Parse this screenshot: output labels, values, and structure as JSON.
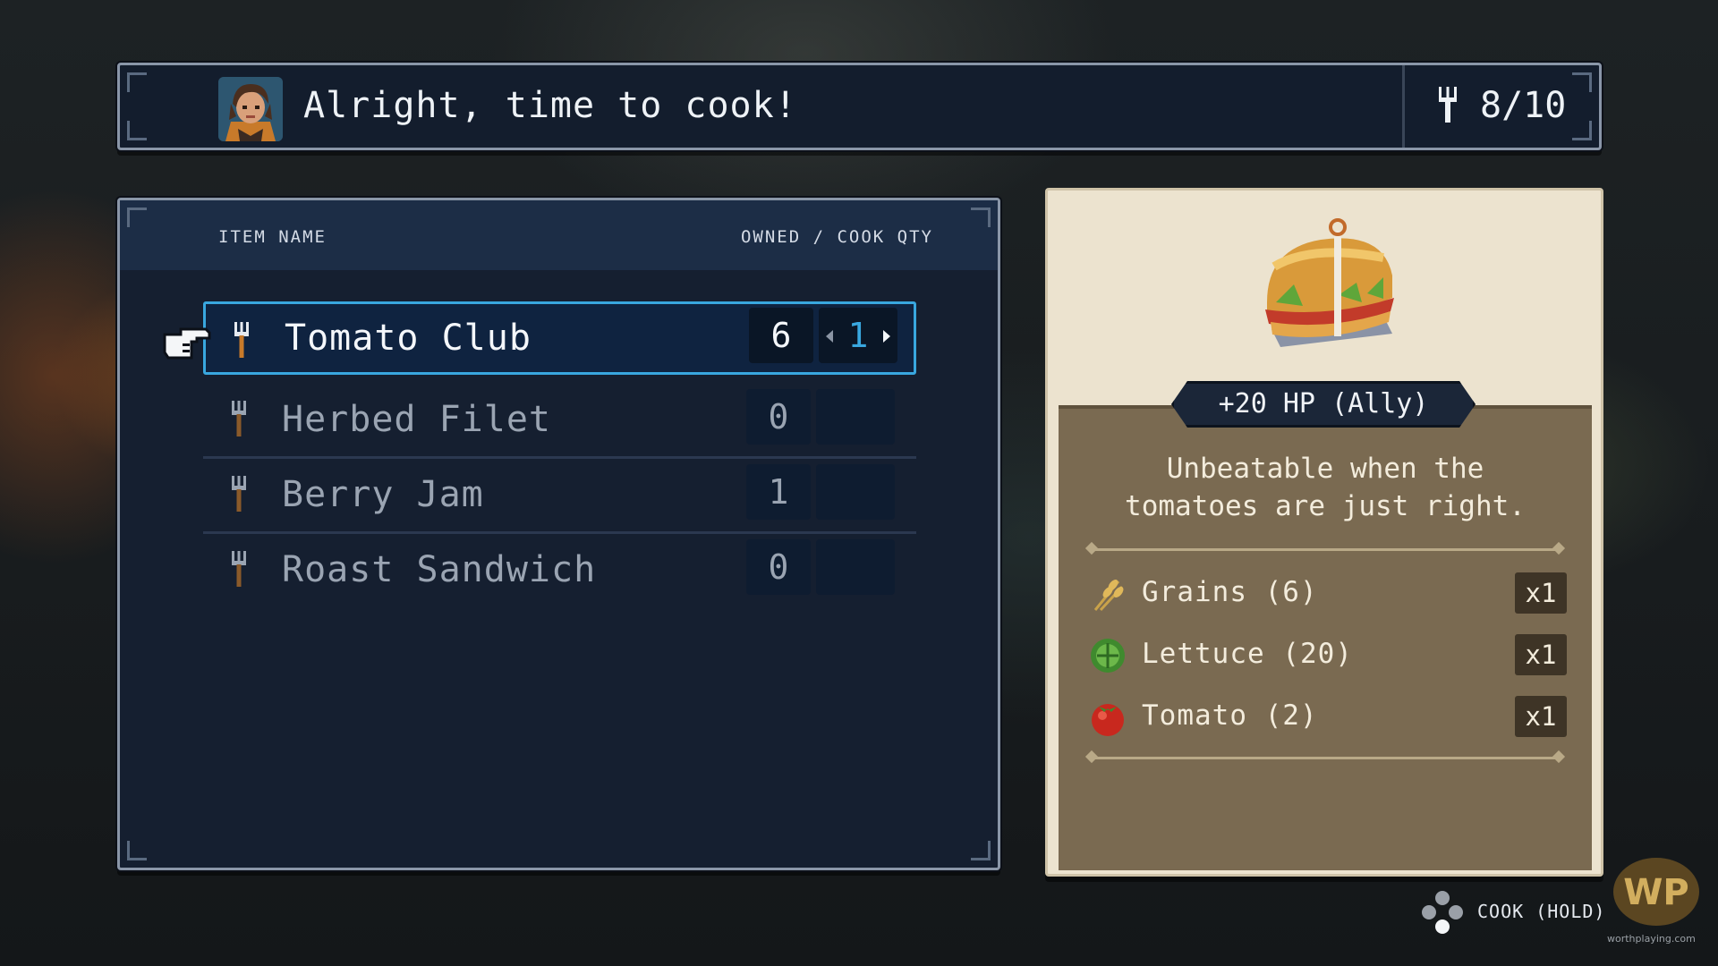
{
  "dialog": {
    "message": "Alright, time to cook!",
    "meal_count": "8/10"
  },
  "recipe_list": {
    "header_name": "ITEM NAME",
    "header_owned": "OWNED / COOK QTY",
    "items": [
      {
        "name": "Tomato Club",
        "owned": "6",
        "cook_qty": "1",
        "selected": true
      },
      {
        "name": "Herbed Filet",
        "owned": "0",
        "cook_qty": ""
      },
      {
        "name": "Berry Jam",
        "owned": "1",
        "cook_qty": ""
      },
      {
        "name": "Roast Sandwich",
        "owned": "0",
        "cook_qty": ""
      }
    ]
  },
  "detail": {
    "effect": "+20 HP (Ally)",
    "description": "Unbeatable when the\ntomatoes are just right.",
    "ingredients": [
      {
        "name": "Grains (6)",
        "mult": "x1",
        "icon": "grains-icon"
      },
      {
        "name": "Lettuce (20)",
        "mult": "x1",
        "icon": "lettuce-icon"
      },
      {
        "name": "Tomato (2)",
        "mult": "x1",
        "icon": "tomato-icon"
      }
    ]
  },
  "prompt": {
    "label": "COOK (HOLD)"
  },
  "watermark": {
    "logo": "WP",
    "url": "worthplaying.com"
  },
  "colors": {
    "panel_bg": "#151f30",
    "header_bg": "#1c2d46",
    "selection": "#39a7df",
    "card_bg": "#ece3cf",
    "card_inner": "#7a6a51"
  }
}
